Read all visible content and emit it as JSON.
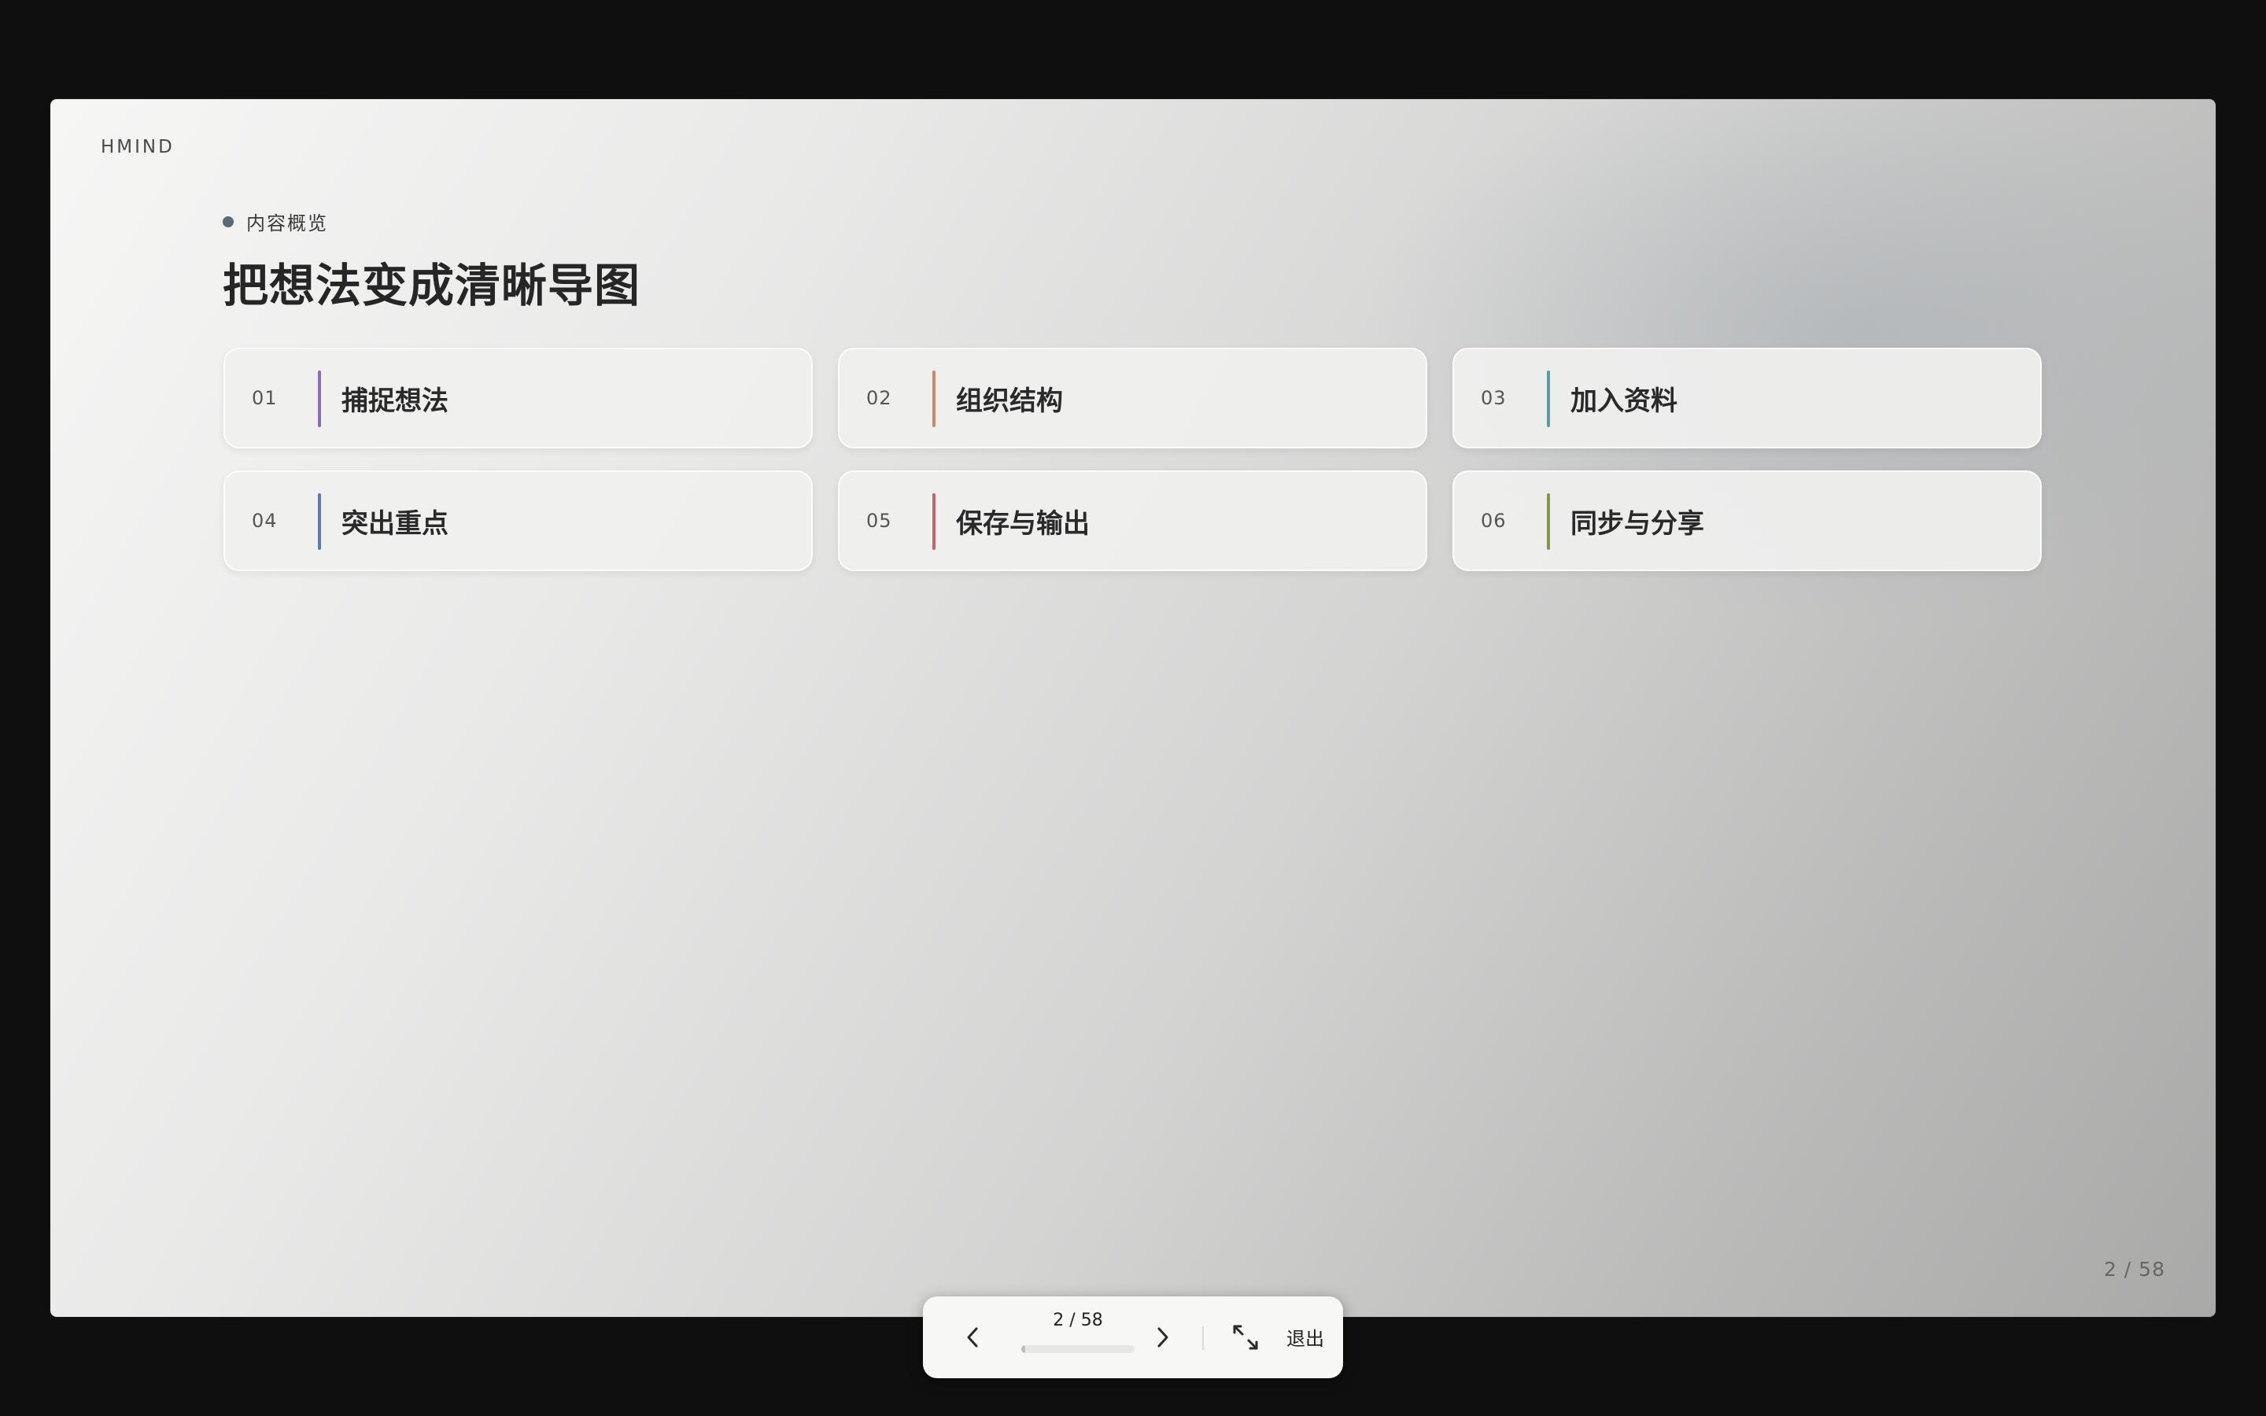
{
  "slide": {
    "brand": "HMIND",
    "eyebrow": "内容概览",
    "title": "把想法变成清晰导图",
    "page_indicator": "2 / 58",
    "cards": [
      {
        "num": "01",
        "label": "捕捉想法",
        "accent": "#8a6fb8"
      },
      {
        "num": "02",
        "label": "组织结构",
        "accent": "#c78a63"
      },
      {
        "num": "03",
        "label": "加入资料",
        "accent": "#5a9aa0"
      },
      {
        "num": "04",
        "label": "突出重点",
        "accent": "#5f78b0"
      },
      {
        "num": "05",
        "label": "保存与输出",
        "accent": "#c4636f"
      },
      {
        "num": "06",
        "label": "同步与分享",
        "accent": "#7e9a4a"
      }
    ]
  },
  "controls": {
    "counter": "2 / 58",
    "progress_fraction": 0.034,
    "prev_icon": "chevron-left-icon",
    "next_icon": "chevron-right-icon",
    "fit_icon": "fit-screen-icon",
    "exit_label": "退出"
  },
  "colors": {
    "outer_background": "#0f0f0f",
    "eyebrow_dot": "#5a6b78",
    "title_text": "#262626"
  }
}
